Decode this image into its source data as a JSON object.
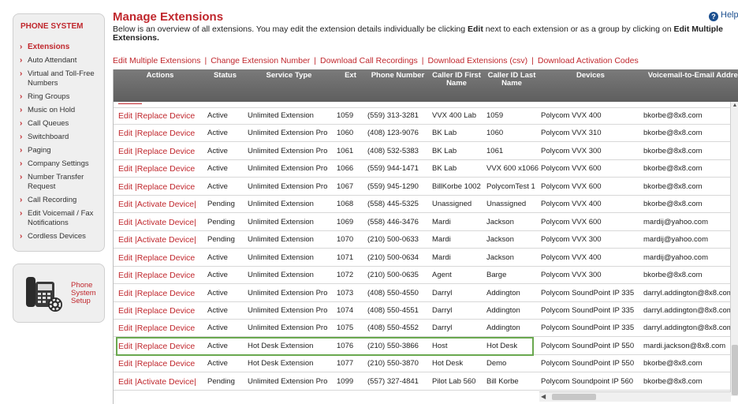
{
  "sidebar": {
    "heading": "PHONE SYSTEM",
    "items": [
      {
        "label": "Extensions",
        "active": true
      },
      {
        "label": "Auto Attendant"
      },
      {
        "label": "Virtual and Toll-Free Numbers"
      },
      {
        "label": "Ring Groups"
      },
      {
        "label": "Music on Hold"
      },
      {
        "label": "Call Queues"
      },
      {
        "label": "Switchboard"
      },
      {
        "label": "Paging"
      },
      {
        "label": "Company Settings"
      },
      {
        "label": "Number Transfer Request"
      },
      {
        "label": "Call Recording"
      },
      {
        "label": "Edit Voicemail / Fax Notifications"
      },
      {
        "label": "Cordless Devices"
      }
    ],
    "setup_label": "Phone System Setup"
  },
  "header": {
    "title": "Manage Extensions",
    "help": "Help",
    "desc_part1": "Below is an overview of all extensions. You may edit the extension details individually be clicking ",
    "desc_edit": "Edit",
    "desc_part2": " next to each extension or as a group by clicking on ",
    "desc_edit_multi": "Edit Multiple Extensions."
  },
  "links": [
    "Edit Multiple Extensions",
    "Change Extension Number",
    "Download Call Recordings",
    "Download Extensions (csv)",
    "Download Activation Codes"
  ],
  "table": {
    "columns": [
      "Actions",
      "Status",
      "Service Type",
      "Ext",
      "Phone Number",
      "Caller ID First Name",
      "Caller ID Last Name",
      "Devices",
      "Voicemail-to-Email Address"
    ],
    "rows": [
      [
        "Edit |Replace Device",
        "Active",
        "Unlimited Extension",
        "1059",
        "(559) 313-3281",
        "VVX 400 Lab",
        "1059",
        "Polycom VVX 400",
        "bkorbe@8x8.com"
      ],
      [
        "Edit |Replace Device",
        "Active",
        "Unlimited Extension Pro",
        "1060",
        "(408) 123-9076",
        "BK Lab",
        "1060",
        "Polycom VVX 310",
        "bkorbe@8x8.com"
      ],
      [
        "Edit |Replace Device",
        "Active",
        "Unlimited Extension Pro",
        "1061",
        "(408) 532-5383",
        "BK Lab",
        "1061",
        "Polycom VVX 300",
        "bkorbe@8x8.com"
      ],
      [
        "Edit |Replace Device",
        "Active",
        "Unlimited Extension Pro",
        "1066",
        "(559) 944-1471",
        "BK Lab",
        "VVX 600 x1066",
        "Polycom VVX 600",
        "bkorbe@8x8.com"
      ],
      [
        "Edit |Replace Device",
        "Active",
        "Unlimited Extension Pro",
        "1067",
        "(559) 945-1290",
        "BillKorbe 1002",
        "PolycomTest 1",
        "Polycom VVX 600",
        "bkorbe@8x8.com"
      ],
      [
        "Edit |Activate Device|",
        "Pending",
        "Unlimited Extension",
        "1068",
        "(558) 445-5325",
        "Unassigned",
        "Unassigned",
        "Polycom VVX 400",
        "bkorbe@8x8.com"
      ],
      [
        "Edit |Activate Device|",
        "Pending",
        "Unlimited Extension",
        "1069",
        "(558) 446-3476",
        "Mardi",
        "Jackson",
        "Polycom VVX 600",
        "mardij@yahoo.com"
      ],
      [
        "Edit |Activate Device|",
        "Pending",
        "Unlimited Extension",
        "1070",
        "(210) 500-0633",
        "Mardi",
        "Jackson",
        "Polycom VVX 300",
        "mardij@yahoo.com"
      ],
      [
        "Edit |Replace Device",
        "Active",
        "Unlimited Extension",
        "1071",
        "(210) 500-0634",
        "Mardi",
        "Jackson",
        "Polycom VVX 400",
        "mardij@yahoo.com"
      ],
      [
        "Edit |Replace Device",
        "Active",
        "Unlimited Extension",
        "1072",
        "(210) 500-0635",
        "Agent",
        "Barge",
        "Polycom VVX 300",
        "bkorbe@8x8.com"
      ],
      [
        "Edit |Replace Device",
        "Active",
        "Unlimited Extension Pro",
        "1073",
        "(408) 550-4550",
        "Darryl",
        "Addington",
        "Polycom SoundPoint IP 335",
        "darryl.addington@8x8.com"
      ],
      [
        "Edit |Replace Device",
        "Active",
        "Unlimited Extension Pro",
        "1074",
        "(408) 550-4551",
        "Darryl",
        "Addington",
        "Polycom SoundPoint IP 335",
        "darryl.addington@8x8.com"
      ],
      [
        "Edit |Replace Device",
        "Active",
        "Unlimited Extension Pro",
        "1075",
        "(408) 550-4552",
        "Darryl",
        "Addington",
        "Polycom SoundPoint IP 335",
        "darryl.addington@8x8.com"
      ],
      [
        "Edit |Replace Device",
        "Active",
        "Hot Desk Extension",
        "1076",
        "(210) 550-3866",
        "Host",
        "Hot Desk",
        "Polycom SoundPoint IP 550",
        "mardi.jackson@8x8.com"
      ],
      [
        "Edit |Replace Device",
        "Active",
        "Hot Desk Extension",
        "1077",
        "(210) 550-3870",
        "Hot Desk",
        "Demo",
        "Polycom SoundPoint IP 550",
        "bkorbe@8x8.com"
      ],
      [
        "Edit |Activate Device|",
        "Pending",
        "Unlimited Extension Pro",
        "1099",
        "(557) 327-4841",
        "Pilot Lab 560",
        "Bill Korbe",
        "Polycom Soundpoint IP 560",
        "bkorbe@8x8.com"
      ]
    ]
  },
  "colors": {
    "accent": "#c0272d",
    "header_bg": "#6b6b6b",
    "highlight": "#6aa84f"
  }
}
